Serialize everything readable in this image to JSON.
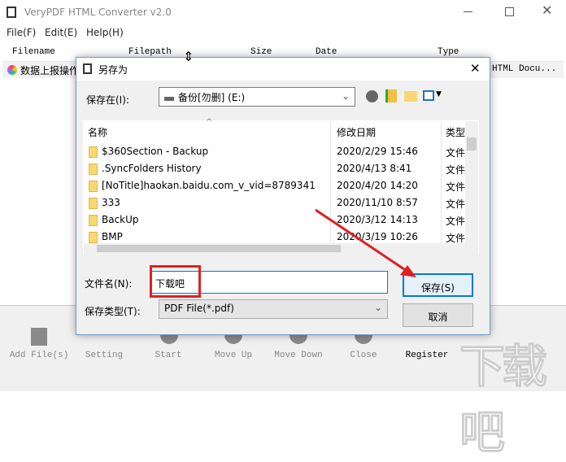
{
  "app": {
    "title": "VeryPDF HTML Converter v2.0",
    "menu": [
      "File(F)",
      "Edit(E)",
      "Help(H)"
    ],
    "columns": [
      "Filename",
      "Filepath",
      "Size",
      "Date",
      "Type"
    ],
    "row": {
      "filename": "数据上报操作",
      "type": "HTML Docu..."
    },
    "toolbar": [
      "Add File(s)",
      "Setting",
      "Start",
      "Move Up",
      "Move Down",
      "Close",
      "Register"
    ]
  },
  "dialog": {
    "title": "另存为",
    "save_in_label": "保存在(I):",
    "save_in_value": "备份[勿删] (E:)",
    "list_headers": [
      "名称",
      "修改日期",
      "类型"
    ],
    "files": [
      {
        "name": "$360Section - Backup",
        "date": "2020/2/29 15:46",
        "type": "文件"
      },
      {
        "name": ".SyncFolders History",
        "date": "2020/4/13 8:41",
        "type": "文件"
      },
      {
        "name": "[NoTitle]haokan.baidu.com_v_vid=8789341",
        "date": "2020/4/20 14:20",
        "type": "文件"
      },
      {
        "name": "333",
        "date": "2020/11/10 8:57",
        "type": "文件"
      },
      {
        "name": "BackUp",
        "date": "2020/3/12 14:13",
        "type": "文件"
      },
      {
        "name": "BMP",
        "date": "2020/3/19 10:26",
        "type": "文件"
      }
    ],
    "filename_label": "文件名(N):",
    "filename_value": "下载吧",
    "filetype_label": "保存类型(T):",
    "filetype_value": "PDF File(*.pdf)",
    "save_button": "保存(S)",
    "cancel_button": "取消"
  },
  "watermark": "下载吧",
  "colors": {
    "annotation": "#e02020",
    "accent": "#0078d7"
  }
}
